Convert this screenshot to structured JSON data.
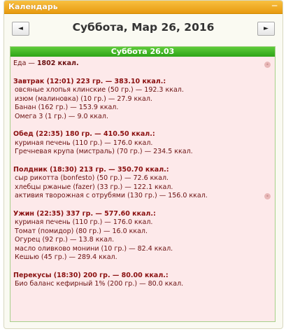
{
  "widget": {
    "title": "Календарь",
    "collapse_icon": "minus-icon"
  },
  "nav": {
    "prev_label": "◄",
    "next_label": "►",
    "date": "Суббота, Мар 26, 2016"
  },
  "day": {
    "header": "Суббота 26.03",
    "total_prefix": "Еда — ",
    "total_value": "1802 ккал.",
    "meals": [
      {
        "title": "Завтрак (12:01) 223 гр. — 383.10 ккал.:",
        "items": [
          "овсяные хлопья клинские (50 гр.) — 192.3 ккал.",
          "изюм (малиновка) (10 гр.) — 27.9 ккал.",
          "Банан (162 гр.) — 153.9 ккал.",
          "Омега 3 (1 гр.) — 9.0 ккал."
        ]
      },
      {
        "title": "Обед (22:35) 180 гр. — 410.50 ккал.:",
        "items": [
          "куриная печень (110 гр.) — 176.0 ккал.",
          "Гречневая крупа (мистраль) (70 гр.) — 234.5 ккал."
        ]
      },
      {
        "title": "Полдник (18:30) 213 гр. — 350.70 ккал.:",
        "items": [
          "сыр рикотта (bonfesto) (50 гр.) — 72.6 ккал.",
          "хлебцы ржаные (fazer) (33 гр.) — 122.1 ккал.",
          "активия творожная с отрубями (130 гр.) — 156.0 ккал."
        ]
      },
      {
        "title": "Ужин (22:35) 337 гр. — 577.60 ккал.:",
        "items": [
          "куриная печень (110 гр.) — 176.0 ккал.",
          "Томат (помидор) (80 гр.) — 16.0 ккал.",
          "Огурец (92 гр.) — 13.8 ккал.",
          "масло оливково монини (10 гр.) — 82.4 ккал.",
          "Кешью (45 гр.) — 289.4 ккал."
        ]
      },
      {
        "title": "Перекусы (18:30) 200 гр. — 80.00 ккал.:",
        "items": [
          "Био баланс кефирный 1% (200 гр.) — 80.0 ккал."
        ]
      }
    ]
  }
}
